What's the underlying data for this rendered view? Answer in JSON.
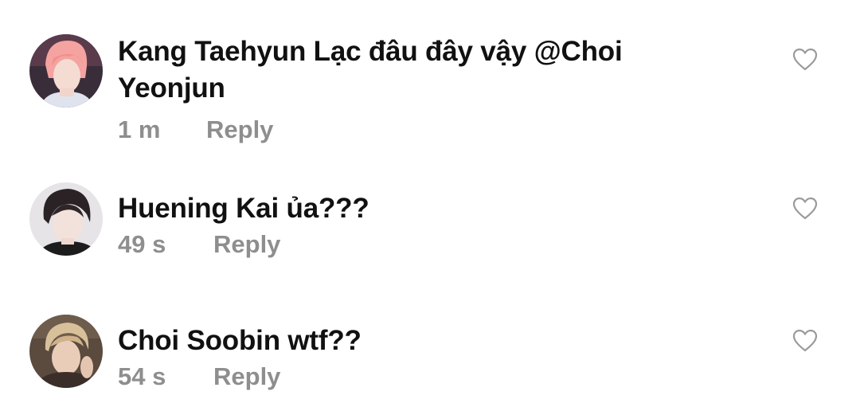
{
  "comments": [
    {
      "author": "Kang Taehyun",
      "text": "Lạc đâu đây vậy @Choi",
      "text_line2": "Yeonjun",
      "time": "1 m",
      "reply_label": "Reply",
      "like_icon": "heart-outline-icon"
    },
    {
      "author": "Huening Kai",
      "text": "ủa???",
      "time": "49 s",
      "reply_label": "Reply",
      "like_icon": "heart-outline-icon"
    },
    {
      "author": "Choi Soobin",
      "text": "wtf??",
      "time": "54 s",
      "reply_label": "Reply",
      "like_icon": "heart-outline-icon"
    }
  ],
  "colors": {
    "text": "#111111",
    "meta": "#8e8e8e",
    "icon": "#9a9a9a",
    "background": "#ffffff"
  }
}
